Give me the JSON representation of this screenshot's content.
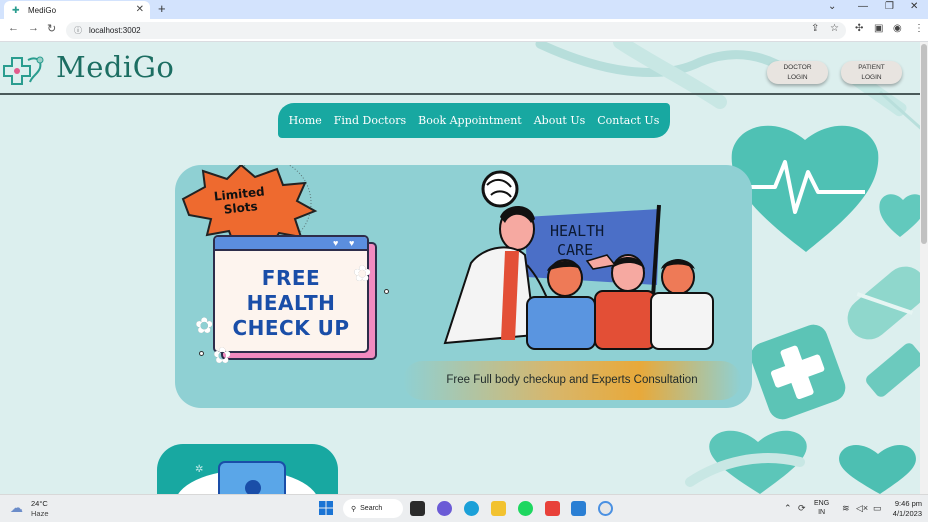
{
  "browser": {
    "tab_title": "MediGo",
    "url": "localhost:3002"
  },
  "site": {
    "logo_text": "MediGo",
    "doctor_login": [
      "DOCTOR",
      "LOGIN"
    ],
    "patient_login": [
      "PATIENT",
      "LOGIN"
    ],
    "nav": [
      "Home",
      "Find Doctors",
      "Book Appointment",
      "About Us",
      "Contact Us"
    ]
  },
  "banner": {
    "badge_lines": [
      "Limited",
      "Slots"
    ],
    "headline_lines": [
      "FREE",
      "HEALTH",
      "CHECK UP"
    ],
    "sign_lines": [
      "HEALTH",
      "CARE"
    ],
    "caption": "Free Full body checkup and Experts Consultation"
  },
  "taskbar": {
    "temperature": "24°C",
    "weather": "Haze",
    "search_label": "Search",
    "language": [
      "ENG",
      "IN"
    ],
    "time": "9:46 pm",
    "date": "4/1/2023"
  },
  "colors": {
    "brand_teal": "#18a8a1",
    "logo_green": "#1c6e62",
    "banner_bg": "#8fd0d3",
    "headline_blue": "#1a4ea8"
  }
}
